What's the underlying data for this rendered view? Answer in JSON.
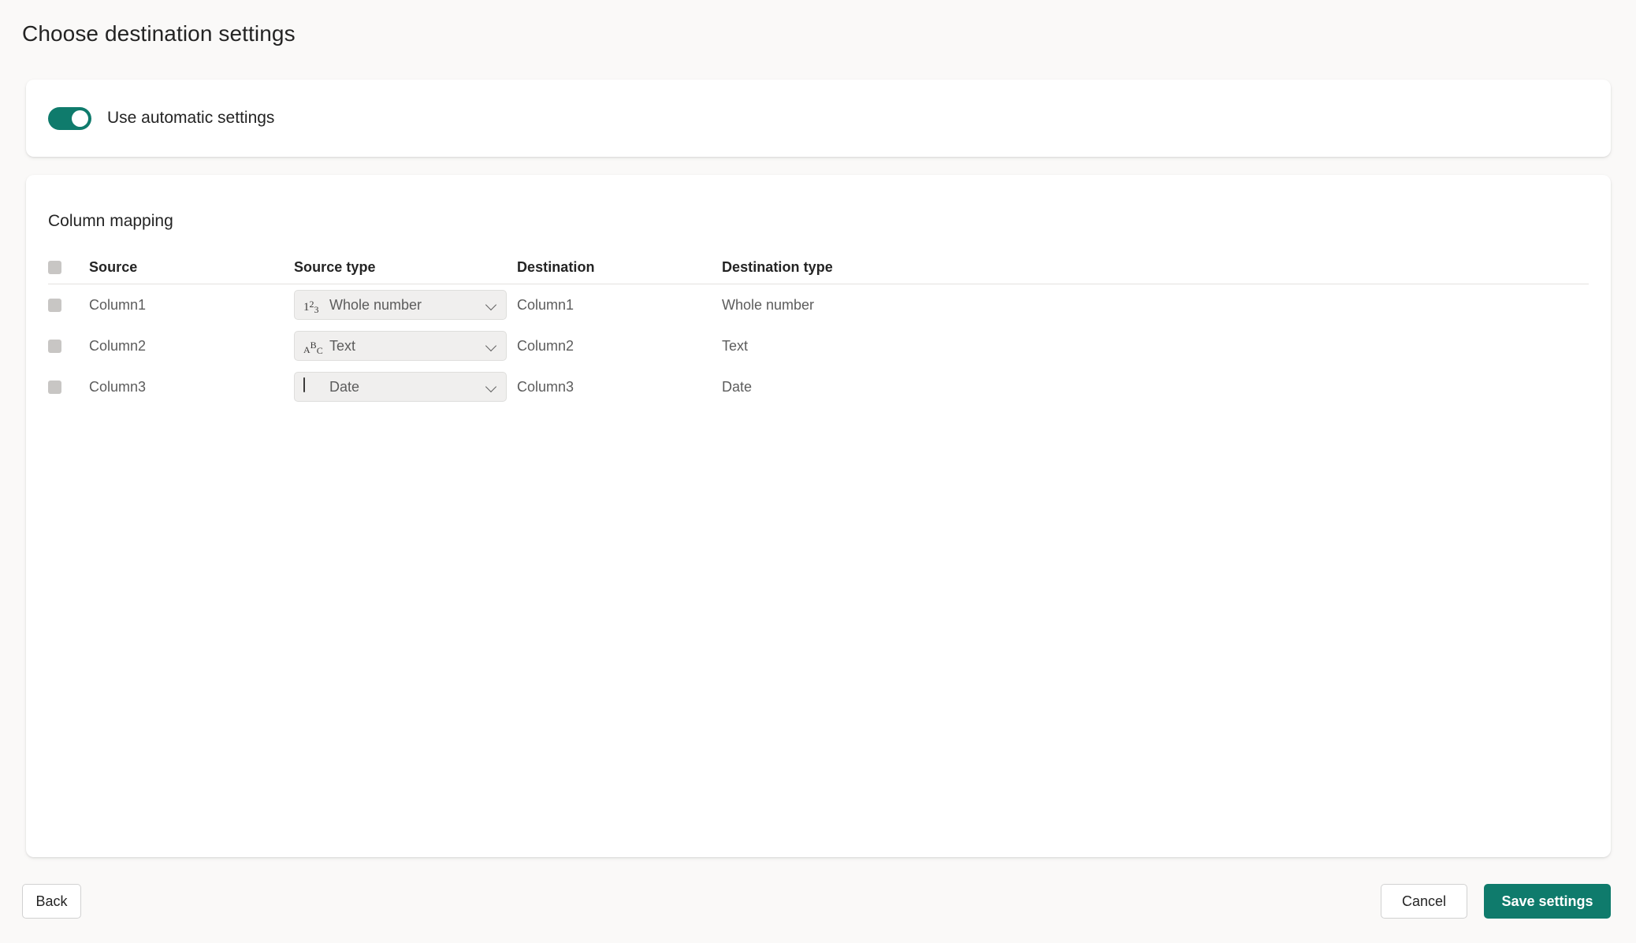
{
  "page": {
    "title": "Choose destination settings",
    "accent_color": "#0f7b6c",
    "background_color": "#faf9f8",
    "card_color": "#ffffff"
  },
  "automatic_settings": {
    "label": "Use automatic settings",
    "toggle_state": "on"
  },
  "column_mapping": {
    "section_title": "Column mapping",
    "headers": {
      "select_all": "",
      "source": "Source",
      "source_type": "Source type",
      "destination": "Destination",
      "destination_type": "Destination type"
    },
    "rows": [
      {
        "selected": false,
        "source": "Column1",
        "source_type": "Whole number",
        "source_type_icon": "number-type-icon",
        "destination": "Column1",
        "destination_type": "Whole number"
      },
      {
        "selected": false,
        "source": "Column2",
        "source_type": "Text",
        "source_type_icon": "text-type-icon",
        "destination": "Column2",
        "destination_type": "Text"
      },
      {
        "selected": false,
        "source": "Column3",
        "source_type": "Date",
        "source_type_icon": "calendar-icon",
        "destination": "Column3",
        "destination_type": "Date"
      }
    ]
  },
  "footer": {
    "back_label": "Back",
    "cancel_label": "Cancel",
    "save_label": "Save settings"
  }
}
